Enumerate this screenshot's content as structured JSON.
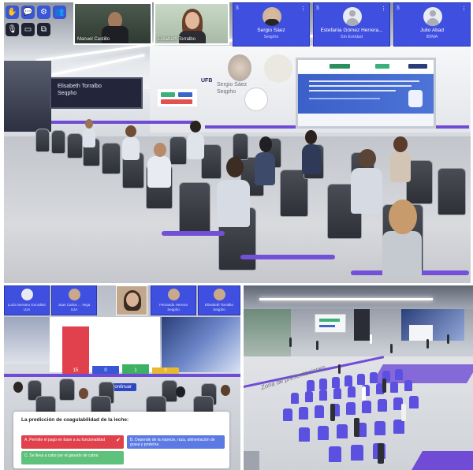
{
  "top_bar": {
    "tool_icons": [
      "hand-icon",
      "chat-icon",
      "settings-icon",
      "people-icon",
      "mic-icon",
      "camera-icon",
      "screen-share-icon"
    ],
    "video_feeds": [
      {
        "name": "Manuel Castillo"
      },
      {
        "name": "Elisabeth Torralbo"
      }
    ],
    "participants": [
      {
        "name": "Sergio Sáez",
        "org": "Seqpho"
      },
      {
        "name": "Estefania Gómez Herrera...",
        "org": "Sin Entidad"
      },
      {
        "name": "Julio Abad",
        "org": "IBIMA"
      }
    ]
  },
  "stage": {
    "screen_name": "Elisabeth Torralbo",
    "screen_org": "Seqpho",
    "holo_name": "Sergio Sáez",
    "holo_org": "Seqpho",
    "logo_text": "UFB"
  },
  "poll": {
    "participants": [
      {
        "name": "Lucía Serrano González",
        "org": "UJA"
      },
      {
        "name": "Juan Carlos ... Vega",
        "org": "UJA"
      },
      {
        "name": "Elisabeth Torralbo",
        "org": "Seqpho"
      },
      {
        "name": "Fernando Herrera",
        "org": "Seqpho"
      }
    ],
    "results": [
      {
        "label": "15",
        "value": 15,
        "color": "#e0414d"
      },
      {
        "label": "0",
        "value": 0,
        "color": "#3856d6"
      },
      {
        "label": "1",
        "value": 1,
        "color": "#3db064"
      },
      {
        "label": "0",
        "value": 0,
        "color": "#e6b92f"
      }
    ],
    "continue_label": "Continuar",
    "question": "La predicción de coagulabilidad de la leche:",
    "answers": [
      {
        "text": "A. Permite el pago en base a su funcionalidad",
        "color": "#e0414d",
        "selected": true
      },
      {
        "text": "B. Depende de la especie, raza, alimentación de grasa y proteína",
        "color": "#5b7ae3",
        "selected": false
      },
      {
        "text": "C. Se lleva a cabo por el ganado de cabra",
        "color": "#5fc27c",
        "selected": false
      }
    ]
  },
  "overview": {
    "floor_text": "Zona de presentaciones"
  }
}
